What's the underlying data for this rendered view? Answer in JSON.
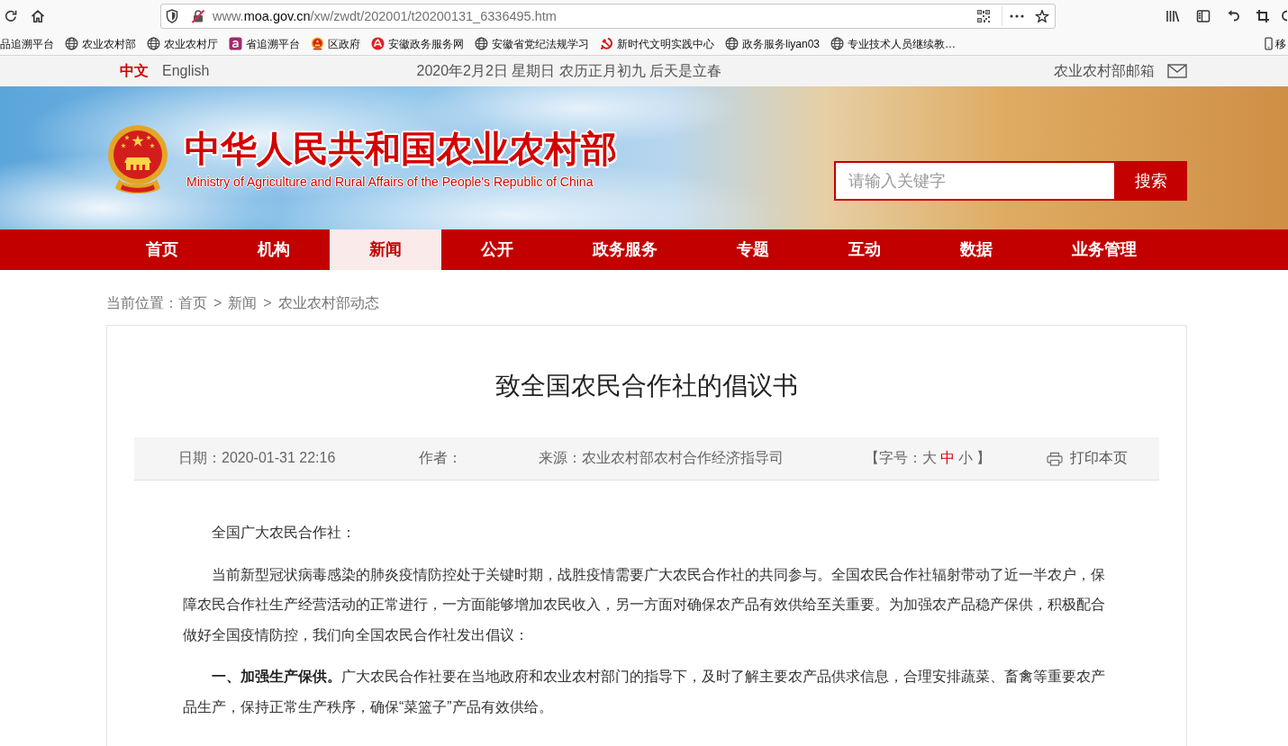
{
  "browser": {
    "url": {
      "prefix": "www.",
      "domain": "moa.gov.cn",
      "path": "/xw/zwdt/202001/t20200131_6336495.htm"
    },
    "bookmarks": [
      {
        "kind": "plain",
        "label": "品追溯平台"
      },
      {
        "kind": "globe",
        "label": "农业农村部"
      },
      {
        "kind": "globe",
        "label": "农业农村厅"
      },
      {
        "kind": "tile",
        "label": "省追溯平台"
      },
      {
        "kind": "emblem",
        "label": "区政府"
      },
      {
        "kind": "swirl",
        "label": "安徽政务服务网"
      },
      {
        "kind": "globe",
        "label": "安徽省党纪法规学习"
      },
      {
        "kind": "sickle",
        "label": "新时代文明实践中心"
      },
      {
        "kind": "globe",
        "label": "政务服务liyan03"
      },
      {
        "kind": "globe",
        "label": "专业技术人员继续教…"
      },
      {
        "kind": "mobile",
        "label": "移"
      }
    ]
  },
  "topbar": {
    "languages": [
      {
        "label": "中文",
        "selected": true
      },
      {
        "label": "English",
        "selected": false
      }
    ],
    "date": "2020年2月2日 星期日 农历正月初九 后天是立春",
    "mail_link": "农业农村部邮箱"
  },
  "banner": {
    "title": "中华人民共和国农业农村部",
    "subtitle": "Ministry of Agriculture and Rural Affairs of the People's Republic of China",
    "search": {
      "placeholder": "请输入关键字",
      "button": "搜索"
    }
  },
  "nav": [
    {
      "label": "首页",
      "selected": false
    },
    {
      "label": "机构",
      "selected": false
    },
    {
      "label": "新闻",
      "selected": true
    },
    {
      "label": "公开",
      "selected": false
    },
    {
      "label": "政务服务",
      "selected": false
    },
    {
      "label": "专题",
      "selected": false
    },
    {
      "label": "互动",
      "selected": false
    },
    {
      "label": "数据",
      "selected": false
    },
    {
      "label": "业务管理",
      "selected": false
    }
  ],
  "breadcrumb": {
    "label": "当前位置：",
    "items": [
      {
        "kind": "link",
        "text": "首页"
      },
      {
        "kind": "separator",
        "text": ">"
      },
      {
        "kind": "link",
        "text": "新闻"
      },
      {
        "kind": "separator",
        "text": ">"
      },
      {
        "kind": "current",
        "text": "农业农村部动态"
      }
    ]
  },
  "article": {
    "title": "致全国农民合作社的倡议书",
    "meta": {
      "date": "日期：2020-01-31 22:16",
      "author": "作者：",
      "source": "来源：农业农村部农村合作经济指导司",
      "font_size": {
        "prefix": "【字号：",
        "options": [
          {
            "label": "大",
            "selected": false
          },
          {
            "label": "中",
            "selected": true
          },
          {
            "label": "小",
            "selected": false
          }
        ],
        "suffix": "】"
      },
      "print": "打印本页"
    },
    "paragraphs": [
      "全国广大农民合作社：",
      "当前新型冠状病毒感染的肺炎疫情防控处于关键时期，战胜疫情需要广大农民合作社的共同参与。全国农民合作社辐射带动了近一半农户，保障农民合作社生产经营活动的正常进行，一方面能够增加农民收入，另一方面对确保农产品有效供给至关重要。为加强农产品稳产保供，积极配合做好全国疫情防控，我们向全国农民合作社发出倡议：",
      "**一、加强生产保供。**广大农民合作社要在当地政府和农业农村部门的指导下，及时了解主要农产品供求信息，合理安排蔬菜、畜禽等重要农产品生产，保持正常生产秩序，确保“菜篮子”产品有效供给。"
    ]
  }
}
